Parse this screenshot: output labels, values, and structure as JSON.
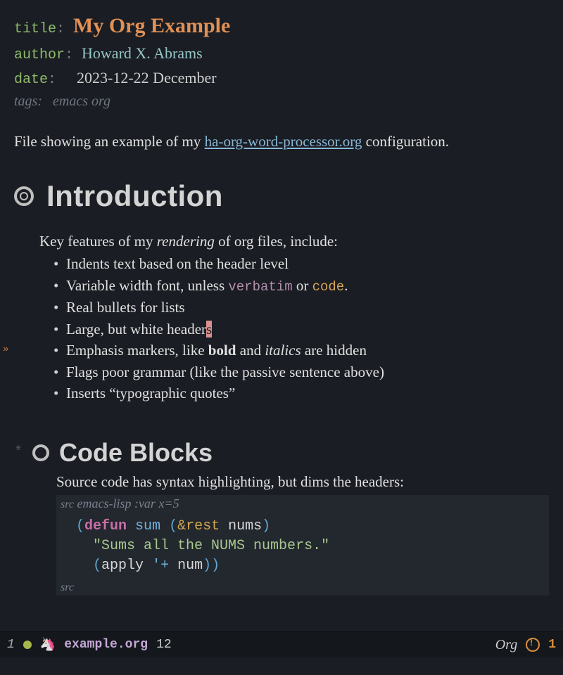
{
  "meta": {
    "title_key": "title",
    "title_val": "My Org Example",
    "author_key": "author",
    "author_val": "Howard X. Abrams",
    "date_key": "date",
    "date_val": "2023-12-22 December",
    "tags_key": "tags:",
    "tags_val": "emacs org"
  },
  "intro_para_pre": "File showing an example of my ",
  "intro_link": "ha-org-word-processor.org",
  "intro_para_post": " configuration.",
  "h1": "Introduction",
  "lead_pre": "Key features of my ",
  "lead_em": "rendering",
  "lead_post": " of org files, include:",
  "features": {
    "f1": "Indents text based on the header level",
    "f2_pre": "Variable width font, unless ",
    "f2_verbatim": "verbatim",
    "f2_mid": " or ",
    "f2_code": "code",
    "f2_post": ".",
    "f3": "Real bullets for lists",
    "f4_pre": "Large, but white header",
    "f4_cursor": "s",
    "f5_pre": "Emphasis markers, like ",
    "f5_bold": "bold",
    "f5_mid": " and ",
    "f5_ital": "italics",
    "f5_post": " are hidden",
    "f6": "Flags poor grammar (like the passive sentence above)",
    "f7": "Inserts “typographic quotes”"
  },
  "h2": "Code Blocks",
  "h2_lead": "Source code has syntax highlighting, but dims the headers:",
  "src_header_kw": "src",
  "src_header_rest": " emacs-lisp :var x=5",
  "code": {
    "l1_defun": "defun",
    "l1_sum": "sum",
    "l1_rest": "&rest",
    "l1_nums": "nums",
    "l2_str": "\"Sums all the NUMS numbers.\"",
    "l3_apply": "apply",
    "l3_plus": "'+",
    "l3_num": "num"
  },
  "src_end": "src",
  "modeline": {
    "win_num": "1",
    "file": "example.org",
    "line": "12",
    "mode": "Org",
    "warn": "1"
  }
}
